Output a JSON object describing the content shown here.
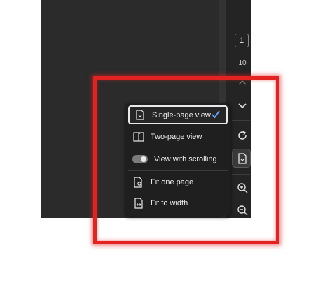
{
  "page_nav": {
    "current_page": "1",
    "total_pages": "10"
  },
  "toolbar_icons": [
    "chevron-up-icon",
    "chevron-down-icon",
    "rotate-icon",
    "page-view-icon",
    "zoom-in-icon",
    "zoom-out-icon"
  ],
  "view_menu": {
    "single_page": "Single-page view",
    "two_page": "Two-page view",
    "scrolling": "View with scrolling",
    "fit_page": "Fit one page",
    "fit_width": "Fit to width",
    "selected_item": "Single-page view",
    "scrolling_enabled": true
  },
  "colors": {
    "viewer_bg": "#2b2b2b",
    "menu_bg": "#1f1f1f",
    "check_accent": "#6aa6ff",
    "highlight": "#e32222"
  }
}
